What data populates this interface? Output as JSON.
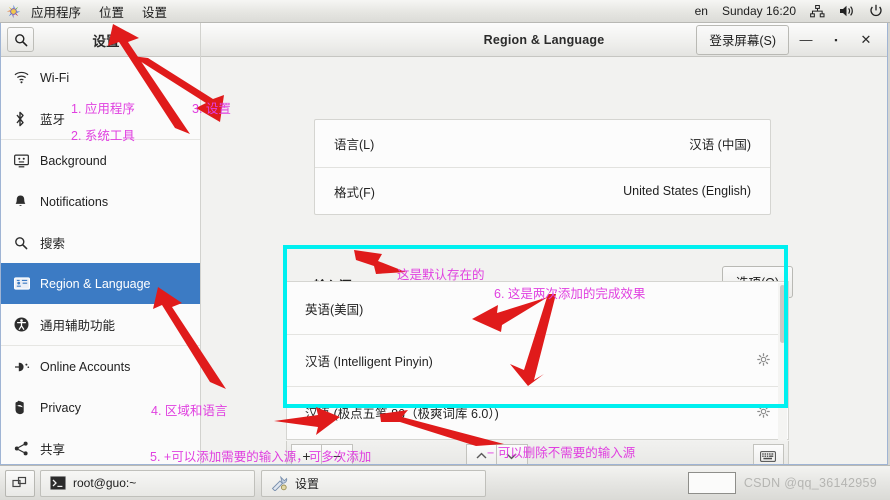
{
  "panel": {
    "menus": [
      "应用程序",
      "位置",
      "设置"
    ],
    "keyboard_layout": "en",
    "clock": "Sunday 16:20",
    "icons": [
      "network-icon",
      "volume-icon",
      "power-icon"
    ]
  },
  "window": {
    "search_icon": "search-icon",
    "sidebar_title": "设置",
    "title": "Region & Language",
    "login_screen_label": "登录屏幕(S)",
    "minimize_label": "—",
    "maximize_label": "▪",
    "close_label": "✕"
  },
  "sidebar": {
    "groups": [
      {
        "items": [
          {
            "label": "Wi-Fi",
            "icon": "wifi-icon",
            "active": false
          },
          {
            "label": "蓝牙",
            "icon": "bluetooth-icon",
            "active": false
          }
        ]
      },
      {
        "items": [
          {
            "label": "Background",
            "icon": "background-icon",
            "active": false
          },
          {
            "label": "Notifications",
            "icon": "bell-icon",
            "active": false
          },
          {
            "label": "搜索",
            "icon": "search-icon",
            "active": false
          },
          {
            "label": "Region & Language",
            "icon": "region-language-icon",
            "active": true
          },
          {
            "label": "通用辅助功能",
            "icon": "accessibility-icon",
            "active": false
          }
        ]
      },
      {
        "items": [
          {
            "label": "Online Accounts",
            "icon": "online-accounts-icon",
            "active": false
          },
          {
            "label": "Privacy",
            "icon": "privacy-hand-icon",
            "active": false
          },
          {
            "label": "共享",
            "icon": "share-icon",
            "active": false
          }
        ]
      }
    ]
  },
  "main": {
    "language_card": [
      {
        "label": "语言(L)",
        "value": "汉语 (中国)"
      },
      {
        "label": "格式(F)",
        "value": "United States (English)"
      }
    ],
    "input_sources_heading": "输入源",
    "options_button": "选项(O)",
    "input_sources": [
      {
        "label": "英语(美国)",
        "gear": false
      },
      {
        "label": "汉语 (Intelligent Pinyin)",
        "gear": true
      },
      {
        "label": "汉语 (极点五笔 86（极爽词库 6.0）)",
        "gear": true
      }
    ],
    "toolbar": {
      "add_label": "+",
      "remove_label": "−",
      "move_up_label": "︿",
      "move_down_label": "﹀",
      "keyboard_preview_icon": "keyboard-icon"
    }
  },
  "annotations": {
    "highlight_color": "#00f0f0",
    "arrow_color": "#e01b1b",
    "text_color": "#e040e0",
    "notes": [
      {
        "id": "n1",
        "text": "1. 应用程序"
      },
      {
        "id": "n2",
        "text": "2. 系统工具"
      },
      {
        "id": "n3",
        "text": "3. 设置"
      },
      {
        "id": "n4",
        "text": "4. 区域和语言"
      },
      {
        "id": "n5",
        "text": "5. +可以添加需要的输入源，可多次添加"
      },
      {
        "id": "n6",
        "text": "6. 这是两次添加的完成效果"
      },
      {
        "id": "n7",
        "text": "这是默认存在的"
      },
      {
        "id": "n8",
        "text": "− 可以删除不需要的输入源"
      }
    ]
  },
  "taskbar": {
    "show_desktop_icon": "show-desktop-icon",
    "tasks": [
      {
        "label": "root@guo:~",
        "icon": "terminal-icon"
      },
      {
        "label": "设置",
        "icon": "settings-tools-icon"
      }
    ],
    "watermark": "CSDN @qq_36142959"
  }
}
